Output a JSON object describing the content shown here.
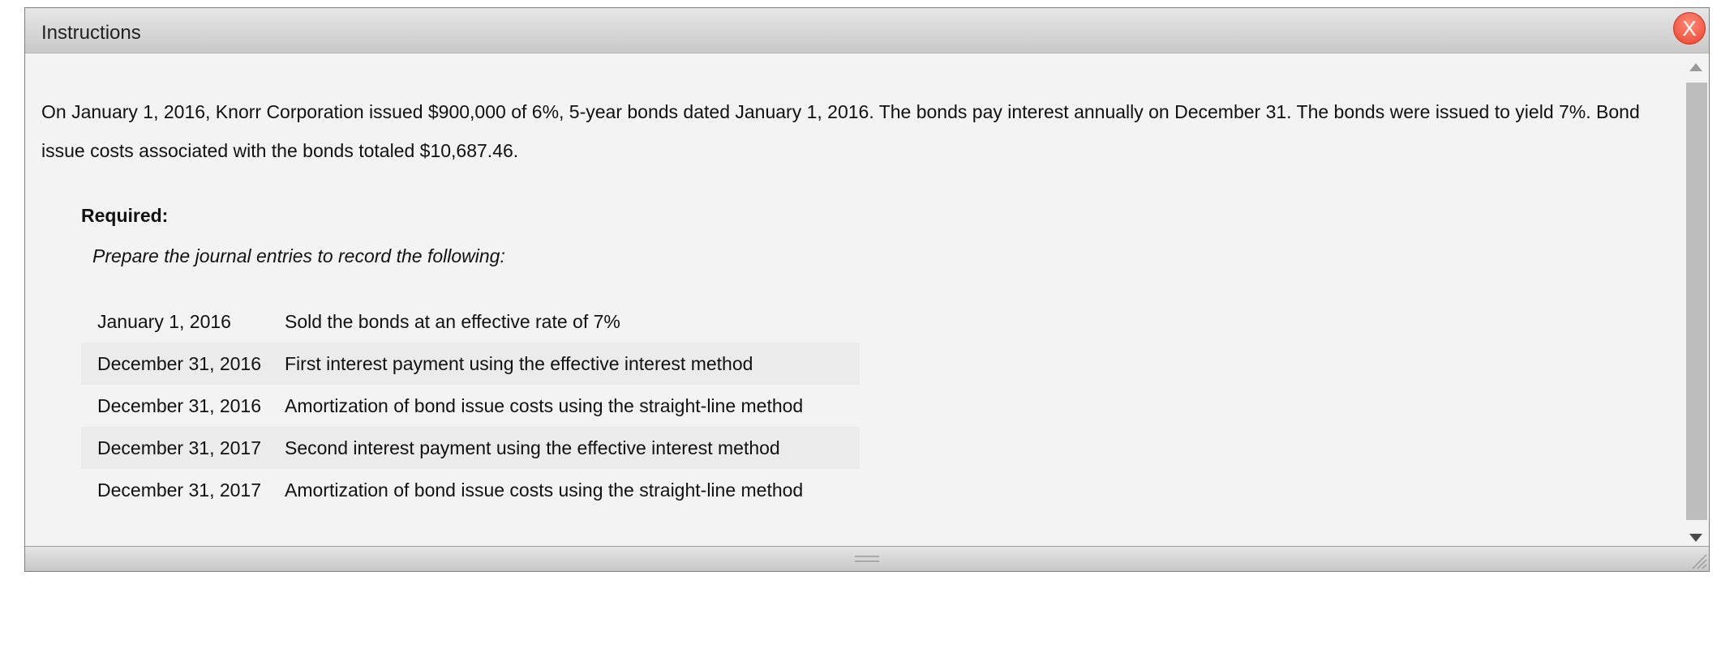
{
  "dialog": {
    "title": "Instructions",
    "close_label": "X"
  },
  "problem": {
    "intro": "On January 1, 2016, Knorr Corporation issued $900,000 of 6%, 5-year bonds dated January 1, 2016. The bonds pay interest annually on December 31. The bonds were issued to yield 7%. Bond issue costs associated with the bonds totaled $10,687.46.",
    "required_label": "Required:",
    "instruction": "Prepare the journal entries to record the following:",
    "tasks": [
      {
        "date": "January 1, 2016",
        "description": "Sold the bonds at an effective rate of 7%"
      },
      {
        "date": "December 31, 2016",
        "description": "First interest payment using the effective interest method"
      },
      {
        "date": "December 31, 2016",
        "description": "Amortization of bond issue costs using the straight-line method"
      },
      {
        "date": "December 31, 2017",
        "description": "Second interest payment using the effective interest method"
      },
      {
        "date": "December 31, 2017",
        "description": "Amortization of bond issue costs using the straight-line method"
      }
    ]
  },
  "icons": {
    "close": "close-icon",
    "scroll_up": "chevron-up-icon",
    "scroll_down": "chevron-down-icon",
    "grip": "drag-grip-icon",
    "resize": "resize-corner-icon"
  },
  "colors": {
    "close_button": "#e8432d",
    "dialog_background": "#f2f3f2",
    "alt_row": "#ebebeb"
  }
}
